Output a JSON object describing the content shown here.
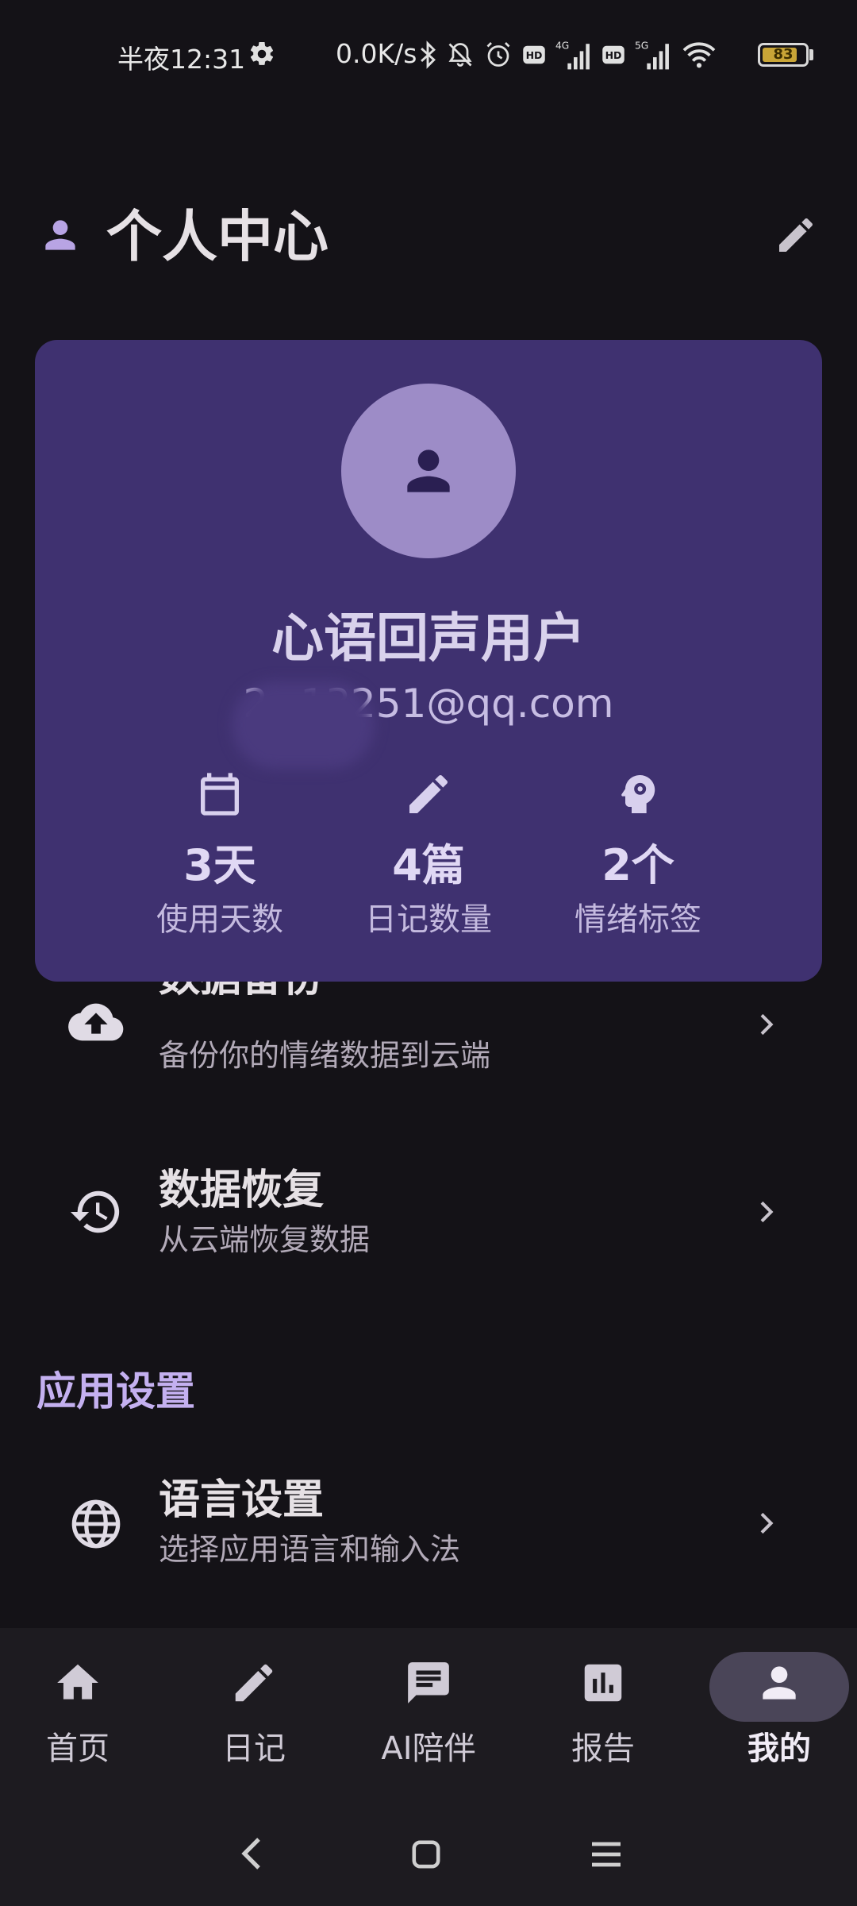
{
  "status_bar": {
    "time": "半夜12:31",
    "net_speed": "0.0K/s",
    "battery": "83",
    "battery_level": 0.83,
    "icons": [
      "settings-icon",
      "bluetooth-icon",
      "mute-icon",
      "alarm-icon",
      "hd-icon",
      "signal-4g-icon",
      "hd-icon",
      "signal-5g-icon",
      "wifi-icon"
    ]
  },
  "header": {
    "title": "个人中心",
    "icon": "person-icon",
    "action_icon": "edit-icon"
  },
  "profile": {
    "name": "心语回声用户",
    "email": "2    13251@qq.com",
    "stats": [
      {
        "icon": "calendar-icon",
        "value": "3天",
        "label": "使用天数"
      },
      {
        "icon": "pencil-icon",
        "value": "4篇",
        "label": "日记数量"
      },
      {
        "icon": "psychology-icon",
        "value": "2个",
        "label": "情绪标签"
      }
    ]
  },
  "list": {
    "backup": {
      "title": "数据备份",
      "subtitle": "备份你的情绪数据到云端",
      "icon": "cloud-upload-icon"
    },
    "restore": {
      "title": "数据恢复",
      "subtitle": "从云端恢复数据",
      "icon": "history-icon"
    },
    "section_app": "应用设置",
    "language": {
      "title": "语言设置",
      "subtitle": "选择应用语言和输入法",
      "icon": "globe-icon"
    }
  },
  "bottom_nav": {
    "items": [
      {
        "label": "首页",
        "icon": "home-icon"
      },
      {
        "label": "日记",
        "icon": "edit-icon"
      },
      {
        "label": "AI陪伴",
        "icon": "chat-icon"
      },
      {
        "label": "报告",
        "icon": "bar-chart-icon"
      },
      {
        "label": "我的",
        "icon": "person-icon",
        "active": true
      }
    ]
  },
  "colors": {
    "background": "#141217",
    "card": "#3f3170",
    "avatar": "#9d8cc7",
    "accent": "#c4b0f0"
  }
}
